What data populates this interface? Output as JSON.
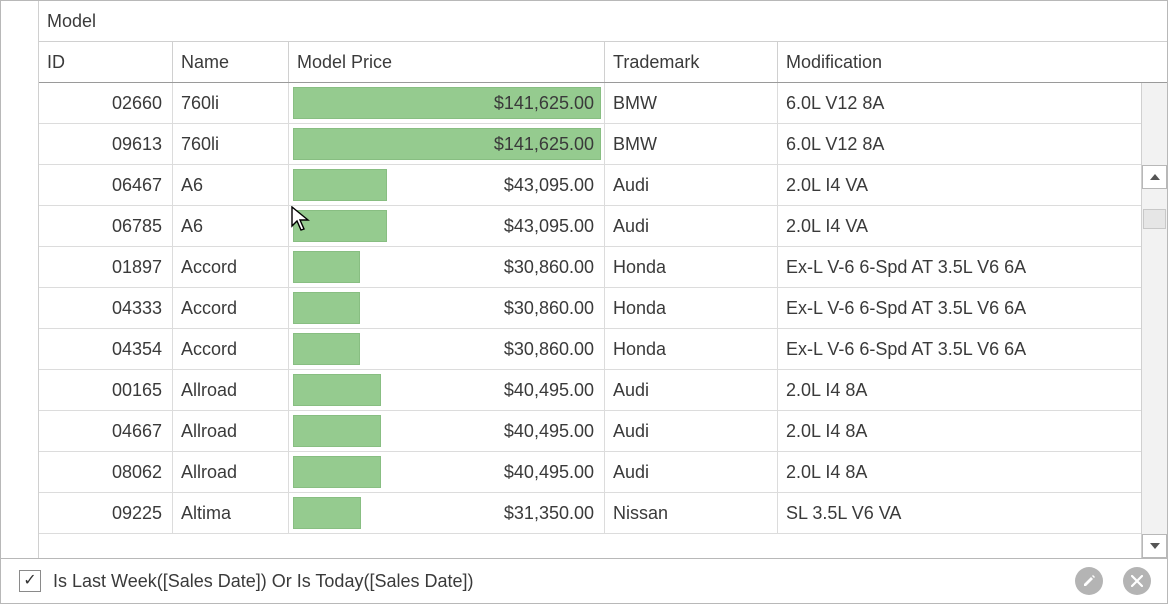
{
  "band_label": "Model",
  "columns": {
    "id": "ID",
    "name": "Name",
    "price": "Model Price",
    "trademark": "Trademark",
    "modification": "Modification"
  },
  "max_price": 141625.0,
  "rows": [
    {
      "id": "02660",
      "name": "760li",
      "price_text": "$141,625.00",
      "price_value": 141625.0,
      "trademark": "BMW",
      "modification": "6.0L V12 8A"
    },
    {
      "id": "09613",
      "name": "760li",
      "price_text": "$141,625.00",
      "price_value": 141625.0,
      "trademark": "BMW",
      "modification": "6.0L V12 8A"
    },
    {
      "id": "06467",
      "name": "A6",
      "price_text": "$43,095.00",
      "price_value": 43095.0,
      "trademark": "Audi",
      "modification": "2.0L I4 VA"
    },
    {
      "id": "06785",
      "name": "A6",
      "price_text": "$43,095.00",
      "price_value": 43095.0,
      "trademark": "Audi",
      "modification": "2.0L I4 VA"
    },
    {
      "id": "01897",
      "name": "Accord",
      "price_text": "$30,860.00",
      "price_value": 30860.0,
      "trademark": "Honda",
      "modification": "Ex-L V-6 6-Spd AT 3.5L V6 6A"
    },
    {
      "id": "04333",
      "name": "Accord",
      "price_text": "$30,860.00",
      "price_value": 30860.0,
      "trademark": "Honda",
      "modification": "Ex-L V-6 6-Spd AT 3.5L V6 6A"
    },
    {
      "id": "04354",
      "name": "Accord",
      "price_text": "$30,860.00",
      "price_value": 30860.0,
      "trademark": "Honda",
      "modification": "Ex-L V-6 6-Spd AT 3.5L V6 6A"
    },
    {
      "id": "00165",
      "name": "Allroad",
      "price_text": "$40,495.00",
      "price_value": 40495.0,
      "trademark": "Audi",
      "modification": "2.0L I4 8A"
    },
    {
      "id": "04667",
      "name": "Allroad",
      "price_text": "$40,495.00",
      "price_value": 40495.0,
      "trademark": "Audi",
      "modification": "2.0L I4 8A"
    },
    {
      "id": "08062",
      "name": "Allroad",
      "price_text": "$40,495.00",
      "price_value": 40495.0,
      "trademark": "Audi",
      "modification": "2.0L I4 8A"
    },
    {
      "id": "09225",
      "name": "Altima",
      "price_text": "$31,350.00",
      "price_value": 31350.0,
      "trademark": "Nissan",
      "modification": "SL 3.5L V6 VA"
    }
  ],
  "filter": {
    "checked": true,
    "text": "Is Last Week([Sales Date]) Or Is Today([Sales Date])"
  },
  "icons": {
    "check": "✓"
  }
}
